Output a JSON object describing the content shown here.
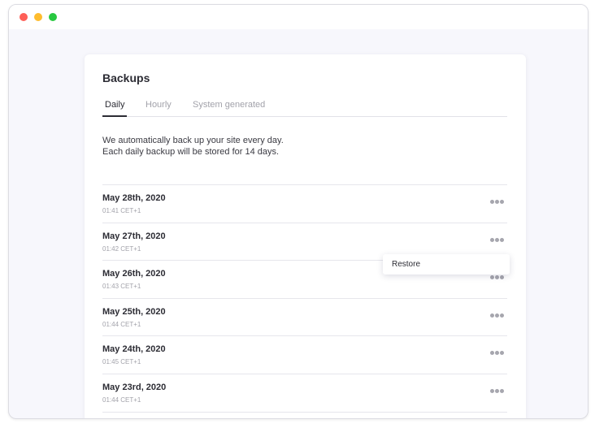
{
  "window": {
    "traffic_lights": [
      "#fe5f57",
      "#febc2e",
      "#28c840"
    ]
  },
  "card": {
    "title": "Backups"
  },
  "tabs": [
    {
      "label": "Daily",
      "active": true
    },
    {
      "label": "Hourly",
      "active": false
    },
    {
      "label": "System generated",
      "active": false
    }
  ],
  "intro": {
    "line1": "We automatically back up your site every day.",
    "line2": "Each daily backup will be stored for 14 days."
  },
  "backups": [
    {
      "date": "May 28th, 2020",
      "time": "01:41 CET+1",
      "menu_icon": "more-horizontal-icon"
    },
    {
      "date": "May 27th, 2020",
      "time": "01:42 CET+1",
      "menu_icon": "more-horizontal-icon"
    },
    {
      "date": "May 26th, 2020",
      "time": "01:43 CET+1",
      "menu_icon": "more-horizontal-icon"
    },
    {
      "date": "May 25th, 2020",
      "time": "01:44 CET+1",
      "menu_icon": "more-horizontal-icon"
    },
    {
      "date": "May 24th, 2020",
      "time": "01:45 CET+1",
      "menu_icon": "more-horizontal-icon"
    },
    {
      "date": "May 23rd, 2020",
      "time": "01:44 CET+1",
      "menu_icon": "more-horizontal-icon"
    }
  ],
  "context_menu": {
    "items": [
      {
        "label": "Restore"
      }
    ]
  }
}
